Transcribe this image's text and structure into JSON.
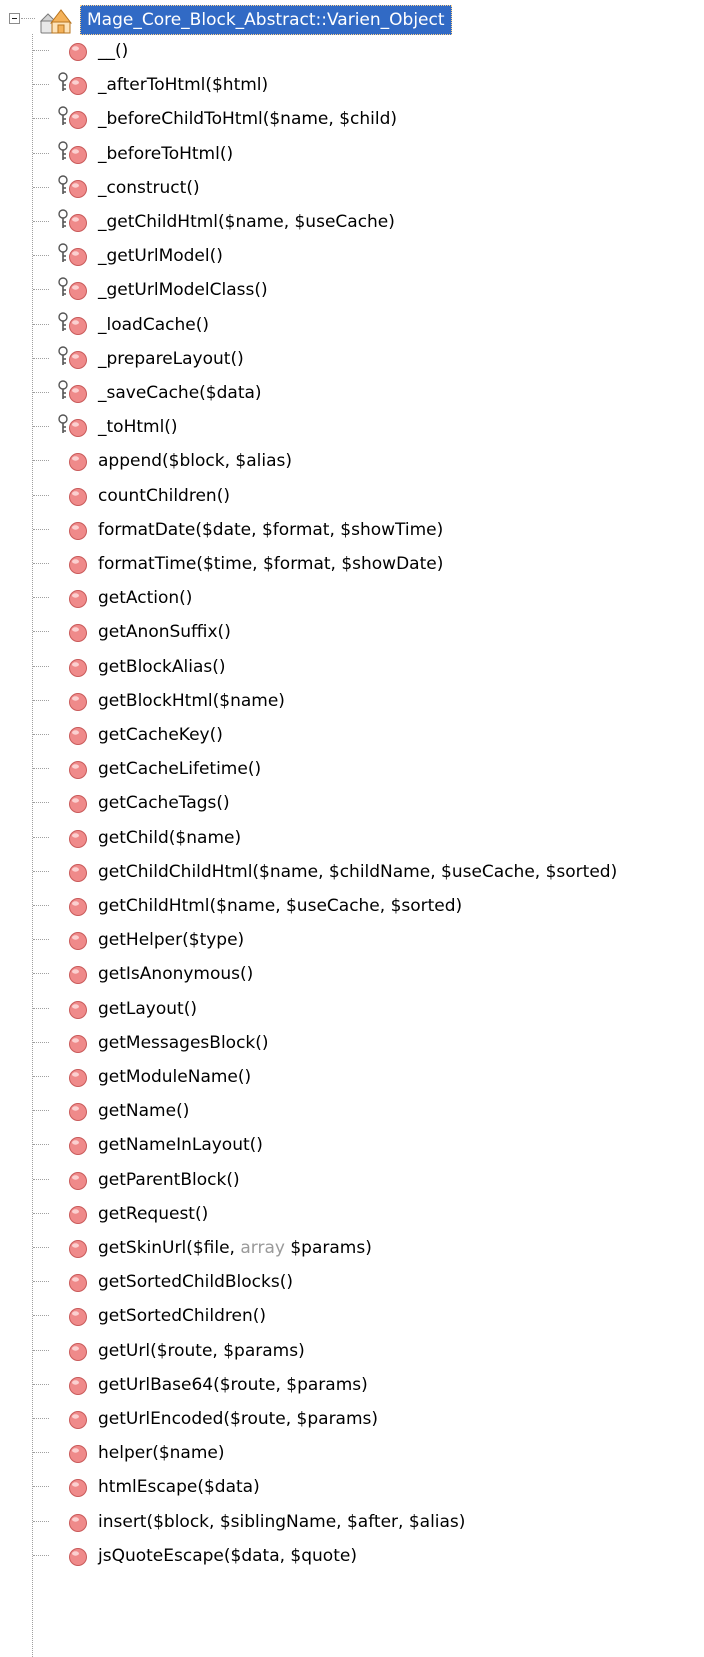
{
  "window": {
    "root_label": "Mage_Core_Block_Abstract::Varien_Object"
  },
  "colors": {
    "selection": "#316ac5",
    "method_icon": "#ef8a8a",
    "keyword_gray": "#9a9a9a",
    "connector": "#a0a0a0"
  },
  "icons": {
    "root": "class-icon",
    "public": "public-method-icon",
    "protected": "protected-method-icon"
  },
  "tree": {
    "items": [
      {
        "label": "__()",
        "icon": "public"
      },
      {
        "label": "_afterToHtml($html)",
        "icon": "protected"
      },
      {
        "label": "_beforeChildToHtml($name, $child)",
        "icon": "protected"
      },
      {
        "label": "_beforeToHtml()",
        "icon": "protected"
      },
      {
        "label": "_construct()",
        "icon": "protected"
      },
      {
        "label": "_getChildHtml($name, $useCache)",
        "icon": "protected"
      },
      {
        "label": "_getUrlModel()",
        "icon": "protected"
      },
      {
        "label": "_getUrlModelClass()",
        "icon": "protected"
      },
      {
        "label": "_loadCache()",
        "icon": "protected"
      },
      {
        "label": "_prepareLayout()",
        "icon": "protected"
      },
      {
        "label": "_saveCache($data)",
        "icon": "protected"
      },
      {
        "label": "_toHtml()",
        "icon": "protected"
      },
      {
        "label": "append($block, $alias)",
        "icon": "public"
      },
      {
        "label": "countChildren()",
        "icon": "public"
      },
      {
        "label": "formatDate($date, $format, $showTime)",
        "icon": "public"
      },
      {
        "label": "formatTime($time, $format, $showDate)",
        "icon": "public"
      },
      {
        "label": "getAction()",
        "icon": "public"
      },
      {
        "label": "getAnonSuffix()",
        "icon": "public"
      },
      {
        "label": "getBlockAlias()",
        "icon": "public"
      },
      {
        "label": "getBlockHtml($name)",
        "icon": "public"
      },
      {
        "label": "getCacheKey()",
        "icon": "public"
      },
      {
        "label": "getCacheLifetime()",
        "icon": "public"
      },
      {
        "label": "getCacheTags()",
        "icon": "public"
      },
      {
        "label": "getChild($name)",
        "icon": "public"
      },
      {
        "label": "getChildChildHtml($name, $childName, $useCache, $sorted)",
        "icon": "public"
      },
      {
        "label": "getChildHtml($name, $useCache, $sorted)",
        "icon": "public"
      },
      {
        "label": "getHelper($type)",
        "icon": "public"
      },
      {
        "label": "getIsAnonymous()",
        "icon": "public"
      },
      {
        "label": "getLayout()",
        "icon": "public"
      },
      {
        "label": "getMessagesBlock()",
        "icon": "public"
      },
      {
        "label": "getModuleName()",
        "icon": "public"
      },
      {
        "label": "getName()",
        "icon": "public"
      },
      {
        "label": "getNameInLayout()",
        "icon": "public"
      },
      {
        "label": "getParentBlock()",
        "icon": "public"
      },
      {
        "label": "getRequest()",
        "icon": "public"
      },
      {
        "parts": [
          "getSkinUrl($file, ",
          "array",
          " $params)"
        ],
        "icon": "public"
      },
      {
        "label": "getSortedChildBlocks()",
        "icon": "public"
      },
      {
        "label": "getSortedChildren()",
        "icon": "public"
      },
      {
        "label": "getUrl($route, $params)",
        "icon": "public"
      },
      {
        "label": "getUrlBase64($route, $params)",
        "icon": "public"
      },
      {
        "label": "getUrlEncoded($route, $params)",
        "icon": "public"
      },
      {
        "label": "helper($name)",
        "icon": "public"
      },
      {
        "label": "htmlEscape($data)",
        "icon": "public"
      },
      {
        "label": "insert($block, $siblingName, $after, $alias)",
        "icon": "public"
      },
      {
        "label": "jsQuoteEscape($data, $quote)",
        "icon": "public"
      }
    ]
  }
}
